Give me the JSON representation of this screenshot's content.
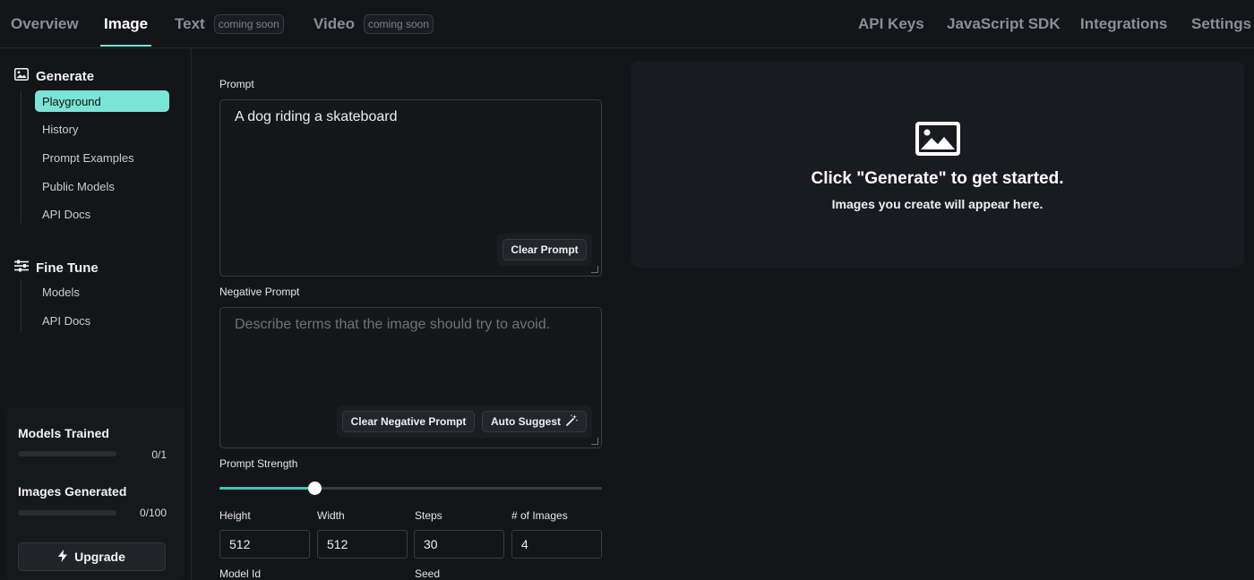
{
  "topnav": {
    "tabs": [
      {
        "label": "Overview",
        "badge": ""
      },
      {
        "label": "Image",
        "badge": ""
      },
      {
        "label": "Text",
        "badge": "coming soon"
      },
      {
        "label": "Video",
        "badge": "coming soon"
      }
    ],
    "active_tab": "Image",
    "right_links": [
      "API Keys",
      "JavaScript SDK",
      "Integrations",
      "Settings"
    ]
  },
  "sidebar": {
    "generate": {
      "title": "Generate",
      "icon": "image-icon",
      "items": [
        "Playground",
        "History",
        "Prompt Examples",
        "Public Models",
        "API Docs"
      ],
      "active": "Playground"
    },
    "fine_tune": {
      "title": "Fine Tune",
      "icon": "sliders-icon",
      "items": [
        "Models",
        "API Docs"
      ]
    },
    "stats": {
      "models_trained": {
        "label": "Models Trained",
        "count": "0/1",
        "progress": 0
      },
      "images_generated": {
        "label": "Images Generated",
        "count": "0/100",
        "progress": 0
      }
    },
    "upgrade_label": "Upgrade"
  },
  "form": {
    "prompt_label": "Prompt",
    "prompt_value": "A dog riding a skateboard",
    "clear_prompt": "Clear Prompt",
    "negative_label": "Negative Prompt",
    "negative_placeholder": "Describe terms that the image should try to avoid.",
    "clear_negative": "Clear Negative Prompt",
    "auto_suggest": "Auto Suggest",
    "strength_label": "Prompt Strength",
    "strength_value": 0.25,
    "height_label": "Height",
    "height_value": "512",
    "width_label": "Width",
    "width_value": "512",
    "steps_label": "Steps",
    "steps_value": "30",
    "images_label": "# of Images",
    "images_value": "4",
    "model_id_label": "Model Id",
    "seed_label": "Seed"
  },
  "output": {
    "icon": "image-icon",
    "title": "Click \"Generate\" to get started.",
    "subtitle": "Images you create will appear here."
  },
  "colors": {
    "accent": "#7ae4d6",
    "slider": "#3cc5b3",
    "background": "#141519"
  }
}
